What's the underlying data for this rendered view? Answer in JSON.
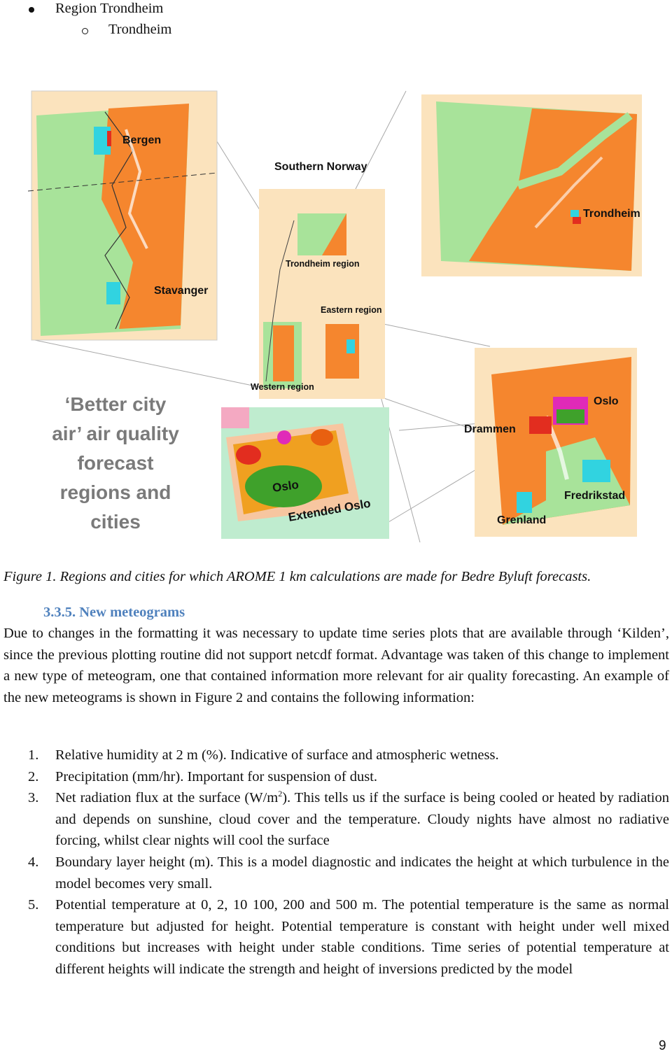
{
  "bullets": {
    "level1": "Region Trondheim",
    "level2": "Trondheim"
  },
  "figure": {
    "tagline_lines": [
      "‘Better city",
      "air’ air quality",
      "forecast",
      "regions and",
      "cities"
    ],
    "labels": {
      "bergen": "Bergen",
      "stavanger": "Stavanger",
      "southern_norway": "Southern Norway",
      "trondheim_region": "Trondheim region",
      "eastern_region": "Eastern region",
      "western_region": "Western region",
      "trondheim": "Trondheim",
      "oslo": "Oslo",
      "drammen": "Drammen",
      "fredrikstad": "Fredrikstad",
      "grenland": "Grenland",
      "oslo_inset": "Oslo",
      "extended_oslo": "Extended Oslo"
    },
    "colors": {
      "sea_green": "#a8e39a",
      "land_orange": "#f5862e",
      "background_land": "#fbe3bd",
      "city_cyan": "#31d3e0",
      "heat_red": "#e22d1f",
      "heat_magenta": "#e02ab8",
      "heat_green": "#3fa12b",
      "tagline_grey": "#7a7a7a"
    }
  },
  "caption": "Figure 1. Regions and cities for which AROME 1 km calculations are made for Bedre Byluft forecasts.",
  "section": {
    "heading": "3.3.5. New meteograms",
    "paragraph": "Due to changes in the formatting it was necessary to update time series plots that are available through ‘Kilden’, since the previous plotting routine did not support netcdf format. Advantage was taken of this change to implement a new type of meteogram, one that contained information more relevant for air quality forecasting. An example of the new meteograms is shown in Figure 2 and contains the following information:"
  },
  "list": [
    {
      "num": "1.",
      "text": "Relative humidity at 2 m (%). Indicative of surface and atmospheric wetness."
    },
    {
      "num": "2.",
      "text": "Precipitation (mm/hr). Important for suspension of dust."
    },
    {
      "num": "3.",
      "text_before": "Net radiation flux at the surface (W/m",
      "sup": "2",
      "text_after": "). This tells us if the surface is being cooled or heated by radiation and depends on sunshine, cloud cover and the temperature. Cloudy nights have almost no radiative forcing, whilst clear nights will cool the surface"
    },
    {
      "num": "4.",
      "text": "Boundary layer height (m). This is a model diagnostic and indicates the height at which turbulence in the model becomes very small."
    },
    {
      "num": "5.",
      "text": "Potential temperature at 0, 2, 10 100, 200 and 500 m. The potential temperature is the same as normal temperature but adjusted for height. Potential temperature is constant with height under well mixed conditions but increases with height under stable conditions. Time series of potential temperature at different heights will indicate the strength and height of inversions predicted by the model"
    }
  ],
  "page_number": "9"
}
